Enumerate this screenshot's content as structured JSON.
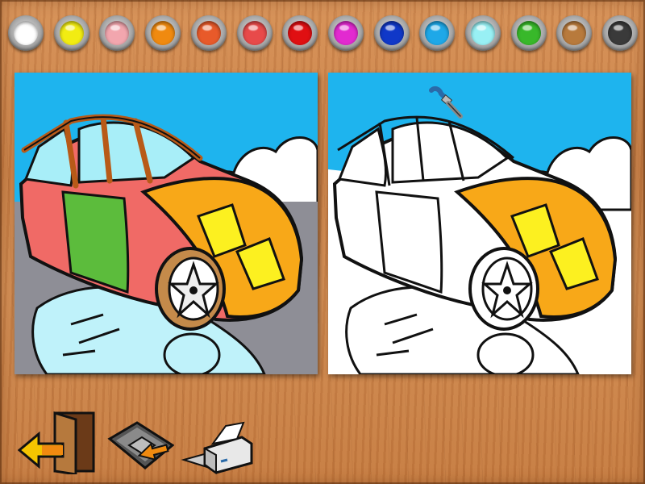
{
  "palette": {
    "colors": [
      {
        "name": "white",
        "hex": "#ffffff"
      },
      {
        "name": "yellow",
        "hex": "#f2ec12"
      },
      {
        "name": "pink",
        "hex": "#f2a6ae"
      },
      {
        "name": "orange",
        "hex": "#f08a10"
      },
      {
        "name": "red-orange",
        "hex": "#e85a2a"
      },
      {
        "name": "salmon-red",
        "hex": "#e84a4a"
      },
      {
        "name": "red",
        "hex": "#e00f12"
      },
      {
        "name": "magenta",
        "hex": "#e22ad0"
      },
      {
        "name": "blue",
        "hex": "#1038c8"
      },
      {
        "name": "sky-blue",
        "hex": "#1ea8e8"
      },
      {
        "name": "light-cyan",
        "hex": "#98f0f4"
      },
      {
        "name": "green",
        "hex": "#38b82a"
      },
      {
        "name": "brown",
        "hex": "#b87a3c"
      },
      {
        "name": "dark-gray",
        "hex": "#3a3a3a"
      }
    ]
  },
  "canvas": {
    "sky": "#1eb4ee",
    "cloud": "#ffffff",
    "road": "#8e8e96",
    "body_red": "#f06a66",
    "door_green": "#5cbc3c",
    "hood_orange": "#f8a818",
    "light_yellow": "#fcf020",
    "glass": "#a8eef8",
    "wheel_brown": "#c48a4a",
    "reflection": "#bff2fa",
    "outline": "#111111"
  },
  "toolbar": {
    "exit_icon": "exit-door-icon",
    "open_icon": "open-disk-icon",
    "print_icon": "printer-icon"
  },
  "cursor": {
    "icon": "paintbrush-icon"
  }
}
